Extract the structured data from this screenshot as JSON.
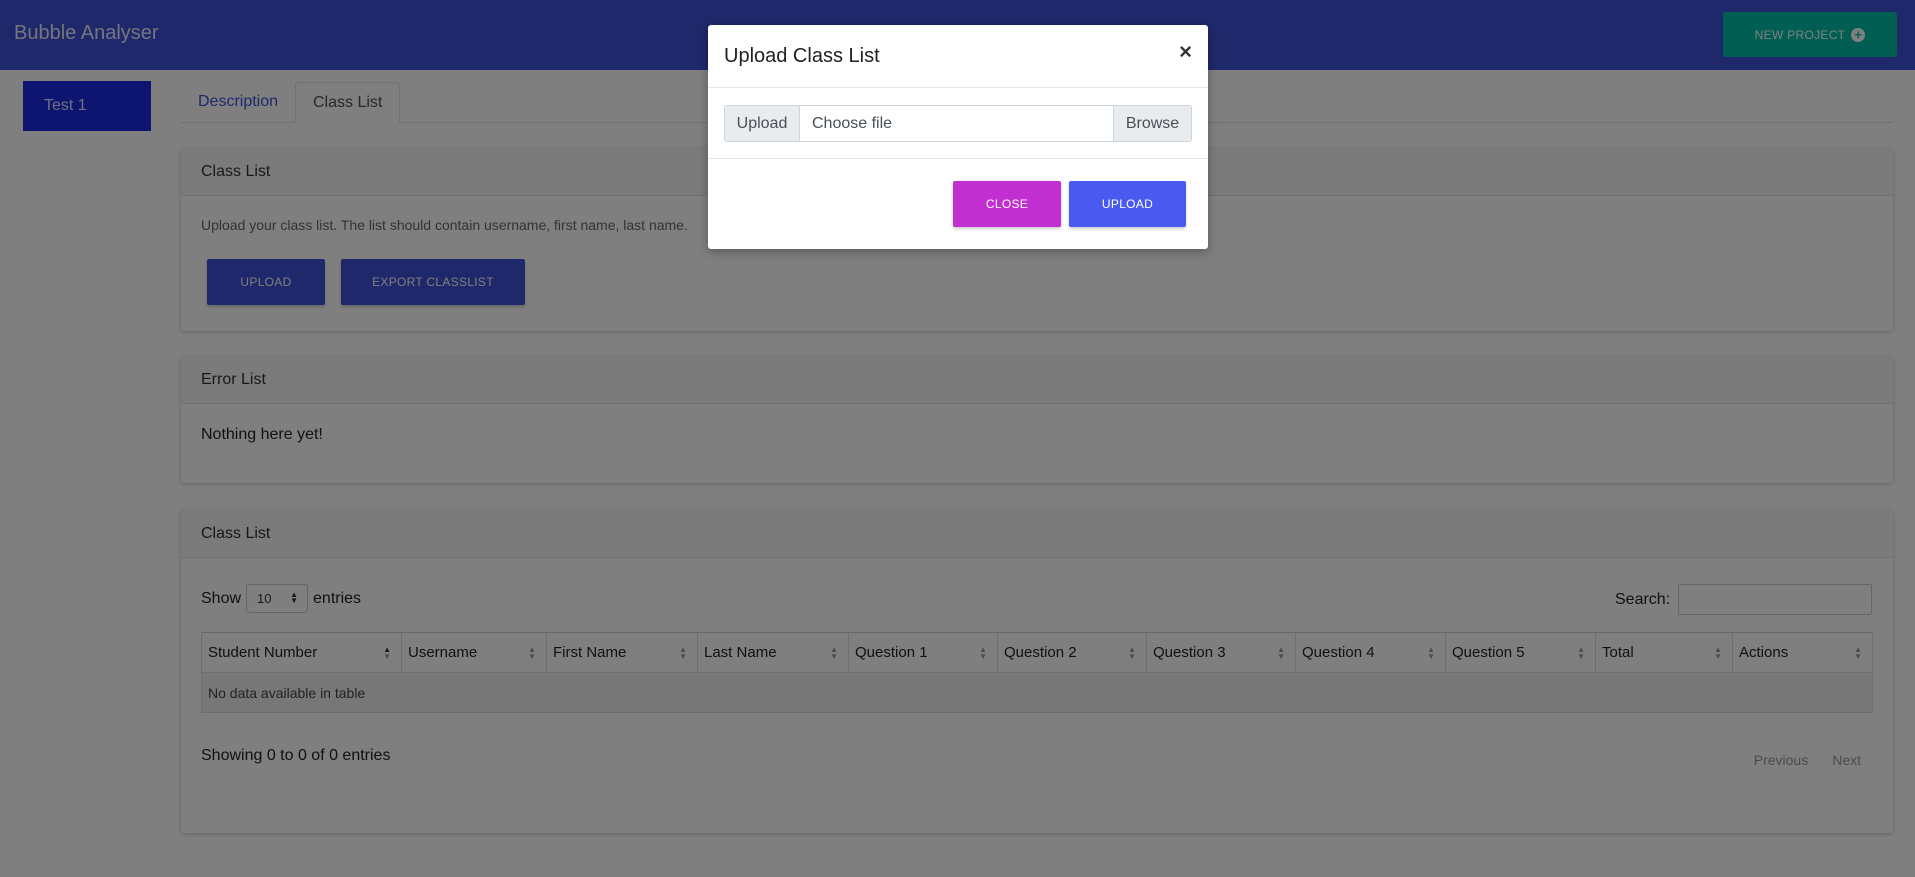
{
  "app": {
    "brand": "Bubble Analyser",
    "new_project_label": "NEW PROJECT"
  },
  "sidebar": {
    "items": [
      {
        "label": "Test 1"
      }
    ]
  },
  "tabs": [
    {
      "label": "Description"
    },
    {
      "label": "Class List"
    }
  ],
  "upload_card": {
    "title": "Class List",
    "description": "Upload your class list. The list should contain username, first name, last name.",
    "upload_label": "UPLOAD",
    "export_label": "EXPORT CLASSLIST"
  },
  "error_card": {
    "title": "Error List",
    "message": "Nothing here yet!"
  },
  "table_card": {
    "title": "Class List",
    "show_label": "Show",
    "entries_value": "10",
    "entries_label": "entries",
    "search_label": "Search:",
    "columns": [
      "Student Number",
      "Username",
      "First Name",
      "Last Name",
      "Question 1",
      "Question 2",
      "Question 3",
      "Question 4",
      "Question 5",
      "Total",
      "Actions"
    ],
    "empty_message": "No data available in table",
    "info": "Showing 0 to 0 of 0 entries",
    "previous_label": "Previous",
    "next_label": "Next"
  },
  "modal": {
    "title": "Upload Class List",
    "close_symbol": "×",
    "file_prefix": "Upload",
    "file_placeholder": "Choose file",
    "browse_label": "Browse",
    "close_label": "CLOSE",
    "upload_label": "UPLOAD"
  },
  "colors": {
    "primary": "#3f51d5",
    "accent_teal": "#00bfa5",
    "close_magenta": "#c22fd0",
    "upload_blue": "#4a59f0"
  }
}
